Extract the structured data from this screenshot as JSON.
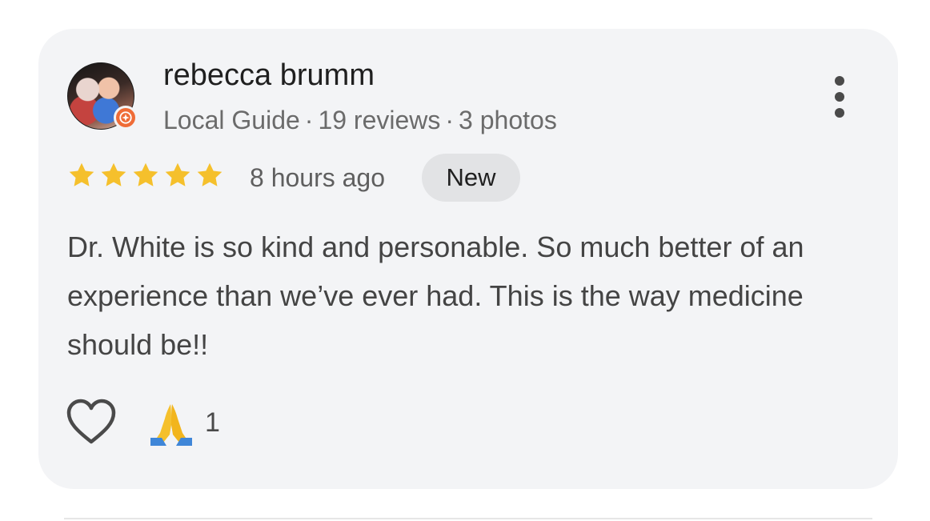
{
  "review": {
    "author_name": "rebecca brumm",
    "author_role": "Local Guide",
    "reviews_count": "19 reviews",
    "photos_count": "3 photos",
    "separator": "·",
    "rating": 5,
    "rating_max": 5,
    "star_color": "#f5c02c",
    "time_ago": "8 hours ago",
    "badge": "New",
    "text": "Dr. White is so kind and personable. So much better of an experience than we’ve ever had. This is the way medicine should be!!",
    "reaction_emoji": "🙏",
    "reaction_count": "1"
  },
  "icons": {
    "more": "more-vert-icon",
    "like": "heart-icon",
    "guide_badge": "local-guide-badge-icon"
  }
}
